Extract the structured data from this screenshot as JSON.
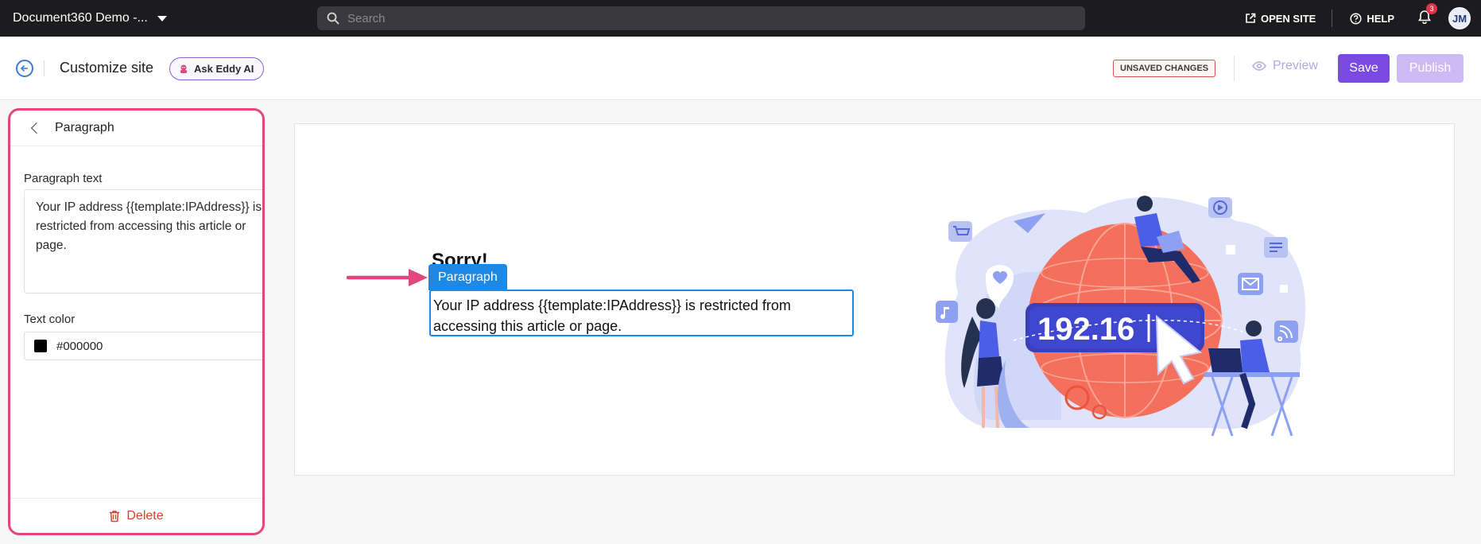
{
  "topbar": {
    "project_name": "Document360 Demo -...",
    "search_placeholder": "Search",
    "open_site": "OPEN SITE",
    "help": "HELP",
    "notification_count": "3",
    "avatar_initials": "JM"
  },
  "header": {
    "title": "Customize site",
    "ask_eddy": "Ask Eddy AI",
    "unsaved": "UNSAVED CHANGES",
    "preview": "Preview",
    "save": "Save",
    "publish": "Publish"
  },
  "panel": {
    "title": "Paragraph",
    "paragraph_text_label": "Paragraph text",
    "paragraph_text_value": "Your IP address {{template:IPAddress}} is restricted from accessing this article or page.",
    "text_color_label": "Text color",
    "text_color_value": "#000000",
    "delete": "Delete"
  },
  "canvas": {
    "heading": "Sorry!",
    "block_tag": "Paragraph",
    "paragraph": "Your IP address {{template:IPAddress}} is restricted from accessing this article or page.",
    "ip_text": "192.16"
  },
  "colors": {
    "accent_purple": "#7b4ae2",
    "publish_disabled": "#cdb9f3",
    "highlight_pink": "#e5457f",
    "selection_blue": "#1e88e5",
    "delete_red": "#d2452f",
    "topbar_bg": "#1c1c1e"
  }
}
